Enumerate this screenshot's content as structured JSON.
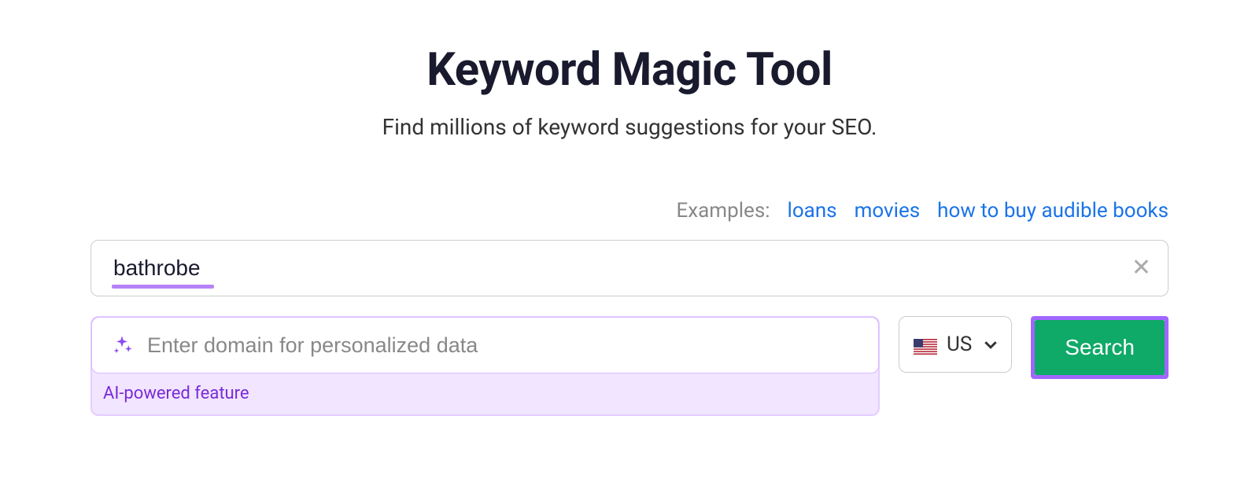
{
  "header": {
    "title": "Keyword Magic Tool",
    "subtitle": "Find millions of keyword suggestions for your SEO."
  },
  "examples": {
    "label": "Examples:",
    "links": [
      "loans",
      "movies",
      "how to buy audible books"
    ]
  },
  "keyword_input": {
    "value": "bathrobe"
  },
  "domain_input": {
    "placeholder": "Enter domain for personalized data",
    "caption": "AI-powered feature"
  },
  "country_select": {
    "code": "US"
  },
  "search_button": {
    "label": "Search"
  }
}
